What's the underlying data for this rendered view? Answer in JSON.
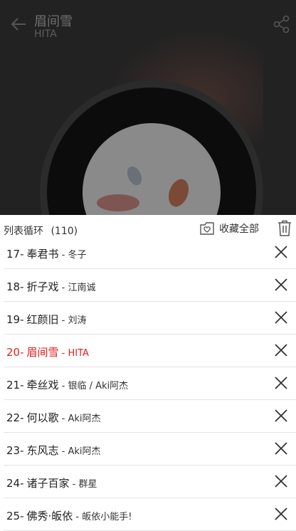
{
  "player": {
    "title": "眉间雪",
    "artist": "HITA"
  },
  "playlist": {
    "mode": "列表循环",
    "count": "(110)",
    "favorite_all": "收藏全部",
    "current_index": 3,
    "items": [
      {
        "num": "17-",
        "title": "奉君书",
        "artist": "冬子"
      },
      {
        "num": "18-",
        "title": "折子戏",
        "artist": "江南诚"
      },
      {
        "num": "19-",
        "title": "红颜旧",
        "artist": "刘涛"
      },
      {
        "num": "20-",
        "title": "眉间雪",
        "artist": "HITA"
      },
      {
        "num": "21-",
        "title": "牵丝戏",
        "artist": "银临 / Aki阿杰"
      },
      {
        "num": "22-",
        "title": "何以歌",
        "artist": "Aki阿杰"
      },
      {
        "num": "23-",
        "title": "东风志",
        "artist": "Aki阿杰"
      },
      {
        "num": "24-",
        "title": "诸子百家",
        "artist": "群星"
      },
      {
        "num": "25-",
        "title": "佛秀·皈依",
        "artist": "皈依小能手!"
      }
    ]
  },
  "icons": {
    "back": "arrow-left-icon",
    "share": "share-icon",
    "favorite": "folder-heart-icon",
    "trash": "trash-icon",
    "remove": "close-icon"
  },
  "colors": {
    "current_track": "#e0201b",
    "overlay": "#222222"
  }
}
